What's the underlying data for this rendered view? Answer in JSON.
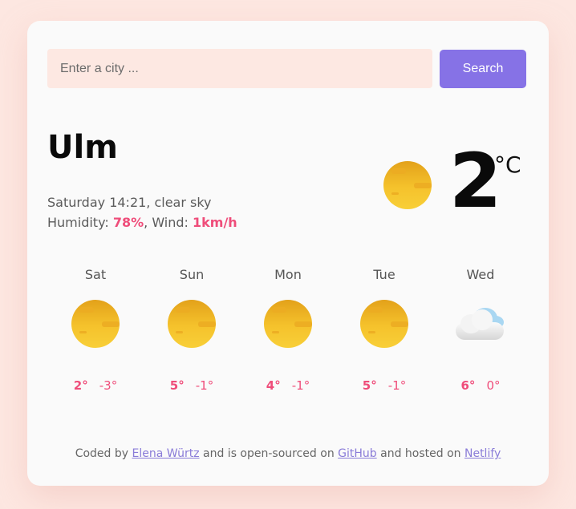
{
  "search": {
    "placeholder": "Enter a city ...",
    "value": "",
    "button_label": "Search"
  },
  "current": {
    "city": "Ulm",
    "date_line": "Saturday 14:21, clear sky",
    "humidity_label": "Humidity: ",
    "humidity": "78%",
    "wind_label": ", Wind: ",
    "wind": "1km/h",
    "temperature": "2",
    "unit": "°C",
    "icon": "sun-icon"
  },
  "forecast": [
    {
      "day": "Sat",
      "max": "2°",
      "min": "-3°",
      "icon": "sun-icon"
    },
    {
      "day": "Sun",
      "max": "5°",
      "min": "-1°",
      "icon": "sun-icon"
    },
    {
      "day": "Mon",
      "max": "4°",
      "min": "-1°",
      "icon": "sun-icon"
    },
    {
      "day": "Tue",
      "max": "5°",
      "min": "-1°",
      "icon": "sun-icon"
    },
    {
      "day": "Wed",
      "max": "6°",
      "min": "0°",
      "icon": "cloud-icon"
    }
  ],
  "footer": {
    "prefix": "Coded by ",
    "author": "Elena Würtz",
    "middle": " and is open-sourced on ",
    "repo": "GitHub",
    "middle2": " and hosted on ",
    "host": "Netlify"
  },
  "colors": {
    "background": "#fde7e1",
    "card": "#fafafa",
    "input_bg": "#fde8e2",
    "accent": "#8672e6",
    "highlight": "#ef4d7a"
  }
}
